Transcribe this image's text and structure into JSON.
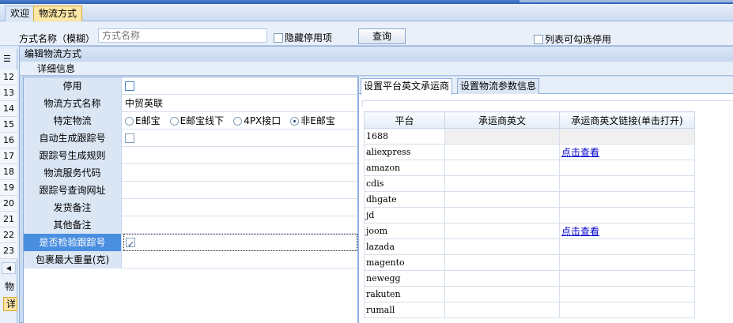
{
  "tabs": [
    {
      "label": "欢迎",
      "active": false
    },
    {
      "label": "物流方式",
      "active": true
    }
  ],
  "filter": {
    "name_label": "方式名称（模糊）",
    "name_placeholder": "方式名称",
    "hide_disabled_label": "隐藏停用项",
    "query_button": "查询",
    "list_selectable_label": "列表可勾选停用"
  },
  "gutter": {
    "row_numbers": [
      "12",
      "13",
      "14",
      "15",
      "16",
      "17",
      "18",
      "19",
      "20",
      "21",
      "22",
      "23"
    ],
    "bottom_text": "物",
    "bottom_tab": "详"
  },
  "dialog": {
    "title": "编辑物流方式",
    "subtitle": "详细信息",
    "fields": [
      {
        "label": "停用",
        "value": "",
        "type": "checkbox",
        "checked": false
      },
      {
        "label": "物流方式名称",
        "value": "中贸英联",
        "type": "text"
      },
      {
        "label": "特定物流",
        "type": "radio",
        "options": [
          "E邮宝",
          "E邮宝线下",
          "4PX接口",
          "非E邮宝"
        ],
        "selected": 3
      },
      {
        "label": "自动生成跟踪号",
        "value": "",
        "type": "checkbox",
        "checked": false
      },
      {
        "label": "跟踪号生成规则",
        "value": "",
        "type": "text"
      },
      {
        "label": "物流服务代码",
        "value": "",
        "type": "text"
      },
      {
        "label": "跟踪号查询网址",
        "value": "",
        "type": "text"
      },
      {
        "label": "发货备注",
        "value": "",
        "type": "text"
      },
      {
        "label": "其他备注",
        "value": "",
        "type": "text"
      },
      {
        "label": "是否检验跟踪号",
        "value": "",
        "type": "checkbox",
        "checked": true,
        "selected_row": true
      },
      {
        "label": "包裹最大重量(克)",
        "value": "",
        "type": "text"
      }
    ],
    "right_tabs": [
      {
        "label": "设置平台英文承运商",
        "active": true
      },
      {
        "label": "设置物流参数信息",
        "active": false
      }
    ],
    "platform_table": {
      "headers": [
        "平台",
        "承运商英文",
        "承运商英文链接(单击打开)"
      ],
      "rows": [
        {
          "platform": "1688",
          "carrier": "",
          "link": ""
        },
        {
          "platform": "aliexpress",
          "carrier": "",
          "link": "点击查看"
        },
        {
          "platform": "amazon",
          "carrier": "",
          "link": ""
        },
        {
          "platform": "cdis",
          "carrier": "",
          "link": ""
        },
        {
          "platform": "dhgate",
          "carrier": "",
          "link": ""
        },
        {
          "platform": "jd",
          "carrier": "",
          "link": ""
        },
        {
          "platform": "joom",
          "carrier": "",
          "link": "点击查看"
        },
        {
          "platform": "lazada",
          "carrier": "",
          "link": ""
        },
        {
          "platform": "magento",
          "carrier": "",
          "link": ""
        },
        {
          "platform": "newegg",
          "carrier": "",
          "link": ""
        },
        {
          "platform": "rakuten",
          "carrier": "",
          "link": ""
        },
        {
          "platform": "rumall",
          "carrier": "",
          "link": ""
        }
      ]
    }
  }
}
